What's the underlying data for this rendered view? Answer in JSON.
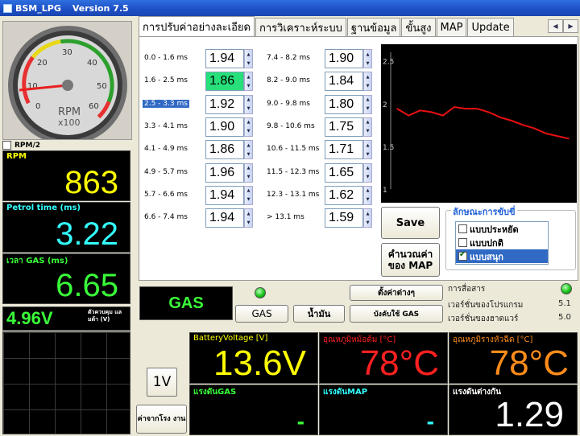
{
  "window": {
    "app": "BSM_LPG",
    "version": "Version 7.5"
  },
  "gauge": {
    "ticks": [
      "0",
      "10",
      "20",
      "30",
      "40",
      "50",
      "60"
    ],
    "unit_line1": "RPM",
    "unit_line2": "x100",
    "rpm2_label": "RPM/2"
  },
  "left_panels": {
    "rpm": {
      "label": "RPM",
      "value": "863",
      "color": "#ffff00"
    },
    "petrol": {
      "label": "Petrol time (ms)",
      "value": "3.22",
      "color": "#33ffff"
    },
    "gas": {
      "label": "เวลา GAS (ms)",
      "value": "6.65",
      "color": "#39ff39"
    },
    "voltage": {
      "value": "4.96V",
      "sublabel": "ตัวควบคุม แลมด้า (V)"
    }
  },
  "tabs": [
    "การปรับค่าอย่างละเอียด",
    "การวิเคราะห์ระบบ",
    "ฐานข้อมูล",
    "ขั้นสูง",
    "MAP",
    "Update"
  ],
  "table": {
    "left": [
      {
        "range": "0.0 - 1.6 ms",
        "value": "1.94"
      },
      {
        "range": "1.6 - 2.5 ms",
        "value": "1.86"
      },
      {
        "range": "2.5 - 3.3 ms",
        "value": "1.92"
      },
      {
        "range": "3.3 - 4.1 ms",
        "value": "1.90"
      },
      {
        "range": "4.1 - 4.9 ms",
        "value": "1.86"
      },
      {
        "range": "4.9 - 5.7 ms",
        "value": "1.96"
      },
      {
        "range": "5.7 - 6.6 ms",
        "value": "1.94"
      },
      {
        "range": "6.6 - 7.4 ms",
        "value": "1.94"
      }
    ],
    "right": [
      {
        "range": "7.4 - 8.2 ms",
        "value": "1.90"
      },
      {
        "range": "8.2 - 9.0 ms",
        "value": "1.84"
      },
      {
        "range": "9.0 - 9.8 ms",
        "value": "1.80"
      },
      {
        "range": "9.8 - 10.6 ms",
        "value": "1.75"
      },
      {
        "range": "10.6 - 11.5 ms",
        "value": "1.71"
      },
      {
        "range": "11.5 - 12.3 ms",
        "value": "1.65"
      },
      {
        "range": "12.3 - 13.1 ms",
        "value": "1.62"
      },
      {
        "range": "> 13.1 ms",
        "value": "1.59"
      }
    ],
    "highlight_color": "#28e07a"
  },
  "chart_data": {
    "type": "line",
    "x": [
      1,
      2,
      3,
      4,
      5,
      6,
      7,
      8,
      9,
      10,
      11,
      12,
      13,
      14,
      15,
      16
    ],
    "series": [
      {
        "values": [
          1.94,
          1.86,
          1.92,
          1.9,
          1.86,
          1.96,
          1.94,
          1.94,
          1.9,
          1.84,
          1.8,
          1.75,
          1.71,
          1.65,
          1.62,
          1.59
        ],
        "color": "#e81010"
      }
    ],
    "yticks": [
      "1",
      "1.5",
      "2",
      "2.5"
    ],
    "ylim": [
      1,
      2.6
    ],
    "grid": false
  },
  "buttons": {
    "save": "Save",
    "calc_map": "คำนวณค่า ของ MAP",
    "defaults": "ตั้งค่าต่างๆ",
    "gas": "GAS",
    "petrol": "น้ำมัน",
    "force_gas": "บังคับใช้ GAS",
    "one_v": "1V",
    "factory": "ค่าจากโรง งาน"
  },
  "mode_group": {
    "title": "ลักษณะการขับขี่",
    "options": [
      {
        "label": "แบบประหยัด",
        "checked": false,
        "selected": false
      },
      {
        "label": "แบบปกติ",
        "checked": false,
        "selected": false
      },
      {
        "label": "แบบสนุก",
        "checked": true,
        "selected": true
      }
    ]
  },
  "fuel_mode": {
    "label": "GAS"
  },
  "status": {
    "comm_label": "การสื่อสาร",
    "program_version_label": "เวอร์ชั่นของโปรแกรม",
    "program_version": "5.1",
    "hw_version_label": "เวอร์ชั่นของฮาดแวร์",
    "hw_version": "5.0"
  },
  "bottom_panels": {
    "battery": {
      "label": "BatteryVoltage [V]",
      "value": "13.6V",
      "label_color": "#ffff00",
      "color": "#ffff00"
    },
    "reducer_temp": {
      "label": "อุณหภูมิหม้อต้ม [°C]",
      "value": "78°C",
      "label_color": "#ff2020",
      "color": "#ff2020"
    },
    "rail_temp": {
      "label": "อุณหภูมิรางหัวฉีด [°C]",
      "value": "78°C",
      "label_color": "#ff8c1a",
      "color": "#ff8c1a"
    },
    "gas_pressure": {
      "label": "แรงดันGAS",
      "value": "-",
      "label_color": "#39ff39",
      "color": "#39ff39"
    },
    "map_pressure": {
      "label": "แรงดันMAP",
      "value": "-",
      "label_color": "#33ffff",
      "color": "#33ffff"
    },
    "diff_pressure": {
      "label": "แรงดันต่างกัน",
      "value": "1.29",
      "label_color": "#ffffff",
      "color": "#ffffff"
    }
  }
}
